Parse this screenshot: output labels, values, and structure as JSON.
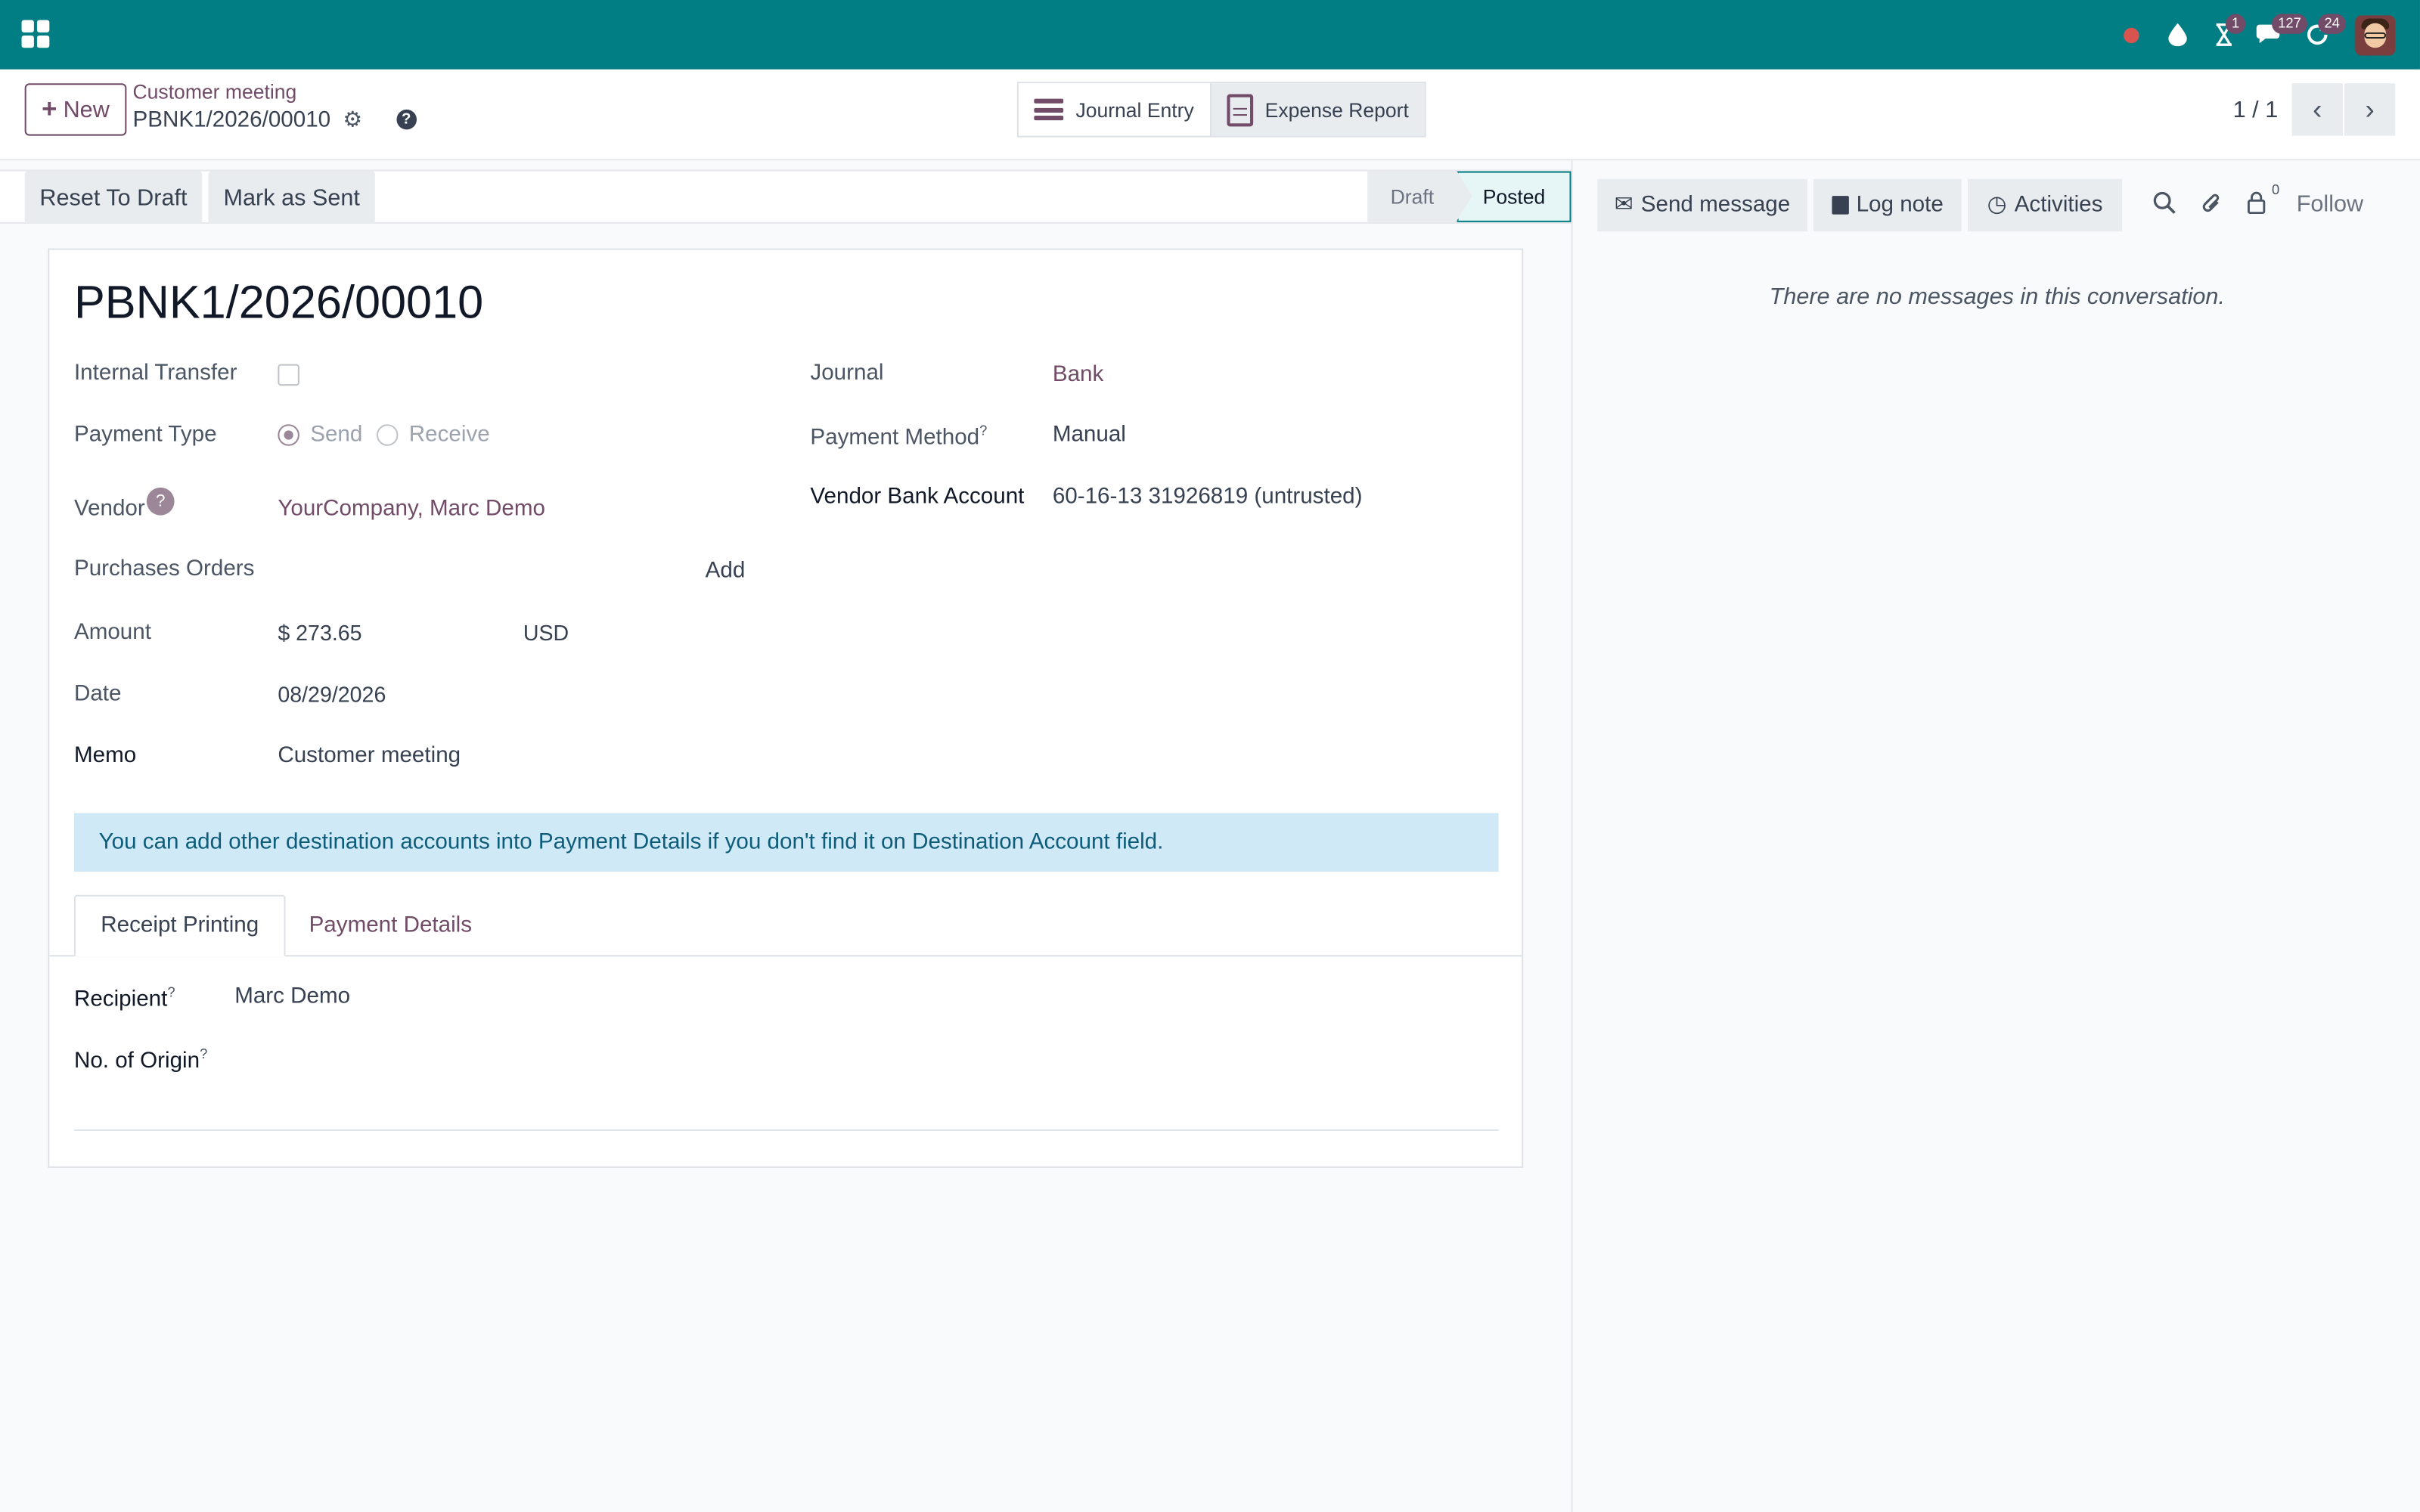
{
  "navbar": {
    "badges": {
      "activities": "1",
      "messages": "127",
      "updates": "24"
    }
  },
  "control_panel": {
    "new_label": "New",
    "breadcrumb_parent": "Customer meeting",
    "breadcrumb_current": "PBNK1/2026/00010",
    "smart_buttons": {
      "journal_entry": "Journal Entry",
      "expense_report": "Expense Report"
    },
    "pager": "1 / 1"
  },
  "statusbar": {
    "reset_to_draft": "Reset To Draft",
    "mark_as_sent": "Mark as Sent",
    "steps": {
      "draft": "Draft",
      "posted": "Posted"
    }
  },
  "form": {
    "title": "PBNK1/2026/00010",
    "labels": {
      "internal_transfer": "Internal Transfer",
      "payment_type": "Payment Type",
      "vendor": "Vendor",
      "purchase_orders": "Purchases Orders",
      "amount": "Amount",
      "date": "Date",
      "memo": "Memo",
      "journal": "Journal",
      "payment_method": "Payment Method",
      "vendor_bank_account": "Vendor Bank Account"
    },
    "values": {
      "payment_type_send": "Send",
      "payment_type_receive": "Receive",
      "vendor": "YourCompany, Marc Demo",
      "purchase_orders_add": "Add",
      "amount": "$ 273.65",
      "currency": "USD",
      "date": "08/29/2026",
      "memo": "Customer meeting",
      "journal": "Bank",
      "payment_method": "Manual",
      "vendor_bank_account": "60-16-13 31926819 (untrusted)"
    },
    "help_mark": "?",
    "alert": "You can add other destination accounts into Payment Details if you don't find it on Destination Account field.",
    "tabs": {
      "receipt_printing": "Receipt Printing",
      "payment_details": "Payment Details"
    },
    "receipt": {
      "recipient_label": "Recipient",
      "recipient_value": "Marc Demo",
      "origin_label": "No. of Origin"
    }
  },
  "chatter": {
    "send_message": "Send message",
    "log_note": "Log note",
    "activities": "Activities",
    "followers_count": "0",
    "follow": "Follow",
    "empty": "There are no messages in this conversation."
  }
}
